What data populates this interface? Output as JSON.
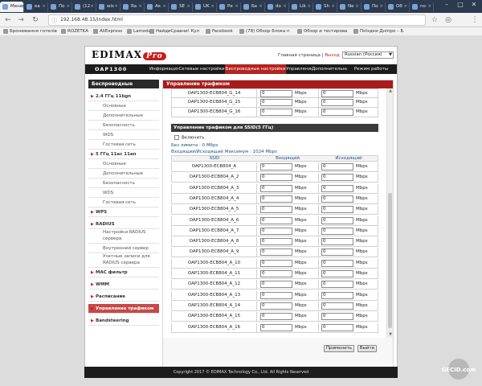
{
  "browser": {
    "tabs": [
      {
        "title": "Меню"
      },
      {
        "title": "ea"
      },
      {
        "title": "По"
      },
      {
        "title": "(12"
      },
      {
        "title": "wis"
      },
      {
        "title": "Ra"
      },
      {
        "title": "Ак"
      },
      {
        "title": "SE"
      },
      {
        "title": "UK"
      },
      {
        "title": "Ре"
      },
      {
        "title": "Бе"
      },
      {
        "title": "do"
      },
      {
        "title": "Lik"
      },
      {
        "title": "Sh"
      },
      {
        "title": "Ne"
      },
      {
        "title": "По"
      },
      {
        "title": "Об"
      },
      {
        "title": "no"
      }
    ],
    "url": "192.168.48.15/index.html",
    "bookmarks": [
      {
        "label": "Бронювання готелів"
      },
      {
        "label": "ROZETKA"
      },
      {
        "label": "AliExpress"
      },
      {
        "label": "Lamoda"
      },
      {
        "label": "НайдиСравни! Куп"
      },
      {
        "label": "Facebook"
      },
      {
        "label": "(78) Обзор блока п"
      },
      {
        "label": "Обзор и тестирова"
      },
      {
        "label": "Поїздки Дніпро – Б"
      }
    ]
  },
  "header": {
    "logo_text": "EDIMAX",
    "logo_pro": "Pro",
    "model": "OAP1300",
    "link_home": "Главная страница",
    "link_sep": " | ",
    "link_logout": "Выход",
    "language": "Russian (Россия)"
  },
  "nav": [
    {
      "label": "Информация"
    },
    {
      "label": "Сетевые настройки"
    },
    {
      "label": "Беспроводные настройки"
    },
    {
      "label": "Управление"
    },
    {
      "label": "Дополнительные"
    },
    {
      "label": "Режим работы"
    }
  ],
  "sidebar": {
    "title": "Беспроводные",
    "items": [
      {
        "label": "2.4 ГГц 11bgn",
        "level": 1
      },
      {
        "label": "Основные",
        "level": 2
      },
      {
        "label": "Дополнительные",
        "level": 2
      },
      {
        "label": "Безопасность",
        "level": 2
      },
      {
        "label": "WDS",
        "level": 2
      },
      {
        "label": "Гостевая сеть",
        "level": 2
      },
      {
        "label": "5 ГГц 11ac 11an",
        "level": 1
      },
      {
        "label": "Основные",
        "level": 2
      },
      {
        "label": "Дополнительные",
        "level": 2
      },
      {
        "label": "Безопасность",
        "level": 2
      },
      {
        "label": "WDS",
        "level": 2
      },
      {
        "label": "Гостевая сеть",
        "level": 2
      },
      {
        "label": "WPS",
        "level": 1
      },
      {
        "label": "RADIUS",
        "level": 1
      },
      {
        "label": "Настройки RADIUS сервера",
        "level": 2
      },
      {
        "label": "Внутренний сервер",
        "level": 2
      },
      {
        "label": "Учетные записи для RADIUS сервера",
        "level": 2
      },
      {
        "label": "MAC фильтр",
        "level": 1
      },
      {
        "label": "WMM",
        "level": 1
      },
      {
        "label": "Расписание",
        "level": 1
      },
      {
        "label": "Управление трафиком",
        "level": 1
      },
      {
        "label": "Bandsteering",
        "level": 1
      }
    ]
  },
  "content": {
    "title": "Управление трафиком",
    "top_rows": [
      {
        "ssid": "OAP1300-ECB804_G_14",
        "in": "0",
        "out": "0"
      },
      {
        "ssid": "OAP1300-ECB804_G_15",
        "in": "0",
        "out": "0"
      },
      {
        "ssid": "OAP1300-ECB804_G_16",
        "in": "0",
        "out": "0"
      }
    ],
    "unit": "Mbps",
    "section_title": "Управление трафиком для SSID(5 ГГц)",
    "enable_label": "Включить",
    "no_limit": "Без лимита : 0 Мбps",
    "max_info": "Входящий/Исходящий Максимум : 1024 Мbps",
    "col_ssid": "SSID",
    "col_in": "Входящий",
    "col_out": "Исходящий",
    "rows": [
      {
        "ssid": "OAP1300-ECB804_A",
        "in": "0",
        "out": "0"
      },
      {
        "ssid": "OAP1300-ECB804_A_2",
        "in": "0",
        "out": "0"
      },
      {
        "ssid": "OAP1300-ECB804_A_3",
        "in": "0",
        "out": "0"
      },
      {
        "ssid": "OAP1300-ECB804_A_4",
        "in": "0",
        "out": "0"
      },
      {
        "ssid": "OAP1300-ECB804_A_5",
        "in": "0",
        "out": "0"
      },
      {
        "ssid": "OAP1300-ECB804_A_6",
        "in": "0",
        "out": "0"
      },
      {
        "ssid": "OAP1300-ECB804_A_7",
        "in": "0",
        "out": "0"
      },
      {
        "ssid": "OAP1300-ECB804_A_8",
        "in": "0",
        "out": "0"
      },
      {
        "ssid": "OAP1300-ECB804_A_9",
        "in": "0",
        "out": "0"
      },
      {
        "ssid": "OAP1300-ECB804_A_10",
        "in": "0",
        "out": "0"
      },
      {
        "ssid": "OAP1300-ECB804_A_11",
        "in": "0",
        "out": "0"
      },
      {
        "ssid": "OAP1300-ECB804_A_12",
        "in": "0",
        "out": "0"
      },
      {
        "ssid": "OAP1300-ECB804_A_13",
        "in": "0",
        "out": "0"
      },
      {
        "ssid": "OAP1300-ECB804_A_14",
        "in": "0",
        "out": "0"
      },
      {
        "ssid": "OAP1300-ECB804_A_15",
        "in": "0",
        "out": "0"
      },
      {
        "ssid": "OAP1300-ECB804_A_16",
        "in": "0",
        "out": "0"
      }
    ],
    "apply_label": "Применить",
    "cancel_label": "Выйти"
  },
  "footer": "Copyright 2017 © EDIMAX Technology Co., Ltd. All Rights Reserved",
  "watermark": "GECID.com",
  "colors": {
    "accent": "#b5231f",
    "nav_bg": "#1c1c1c",
    "tab_bg": "#2b3a4f"
  }
}
